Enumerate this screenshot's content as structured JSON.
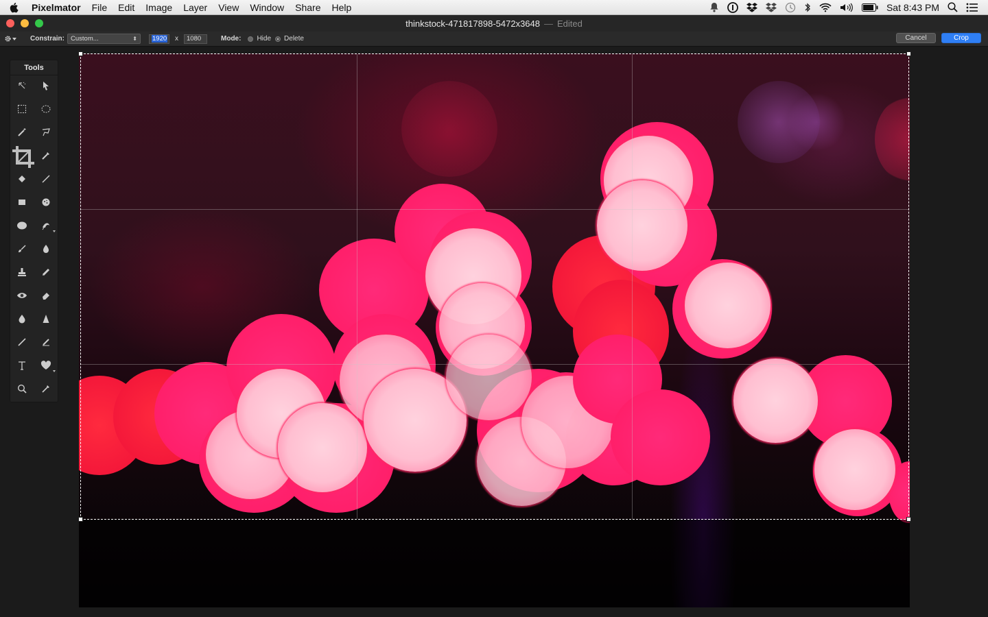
{
  "menubar": {
    "app_name": "Pixelmator",
    "items": [
      "File",
      "Edit",
      "Image",
      "Layer",
      "View",
      "Window",
      "Share",
      "Help"
    ],
    "clock": "Sat 8:43 PM",
    "status_icons": [
      "notification-icon",
      "onepassword-icon",
      "dropbox-alt-icon",
      "dropbox-icon",
      "time-machine-icon",
      "bluetooth-icon",
      "wifi-icon",
      "volume-icon",
      "battery-icon",
      "spotlight-icon",
      "notification-center-icon"
    ]
  },
  "window": {
    "title": "thinkstock-471817898-5472x3648",
    "separator": "—",
    "state": "Edited"
  },
  "options": {
    "constrain_label": "Constrain:",
    "constrain_value": "Custom...",
    "width_value": "1920",
    "times": "x",
    "height_value": "1080",
    "mode_label": "Mode:",
    "mode_options": [
      "Hide",
      "Delete"
    ],
    "mode_selected": "Delete",
    "cancel_label": "Cancel",
    "crop_label": "Crop"
  },
  "tools": {
    "title": "Tools",
    "items": [
      "magic-move-icon",
      "pointer-icon",
      "rect-select-icon",
      "ellipse-select-icon",
      "magic-wand-icon",
      "lasso-icon",
      "crop-icon",
      "eyedropper-icon",
      "paint-bucket-icon",
      "pen-icon",
      "rectangle-shape-icon",
      "sponge-icon",
      "ellipse-icon",
      "smudge-icon",
      "brush-icon",
      "burn-icon",
      "clone-stamp-icon",
      "pencil-icon",
      "red-eye-icon",
      "eraser-icon",
      "blur-drop-icon",
      "sharpen-icon",
      "line-icon",
      "freeform-pen-icon",
      "text-icon",
      "heart-shape-icon",
      "zoom-icon",
      "color-picker-icon"
    ]
  },
  "colors": {
    "accent": "#2f7ff5",
    "bokeh_hot": "#ff1f6a",
    "bokeh_red": "#f4183a",
    "bokeh_pale": "#ffc2d3"
  }
}
